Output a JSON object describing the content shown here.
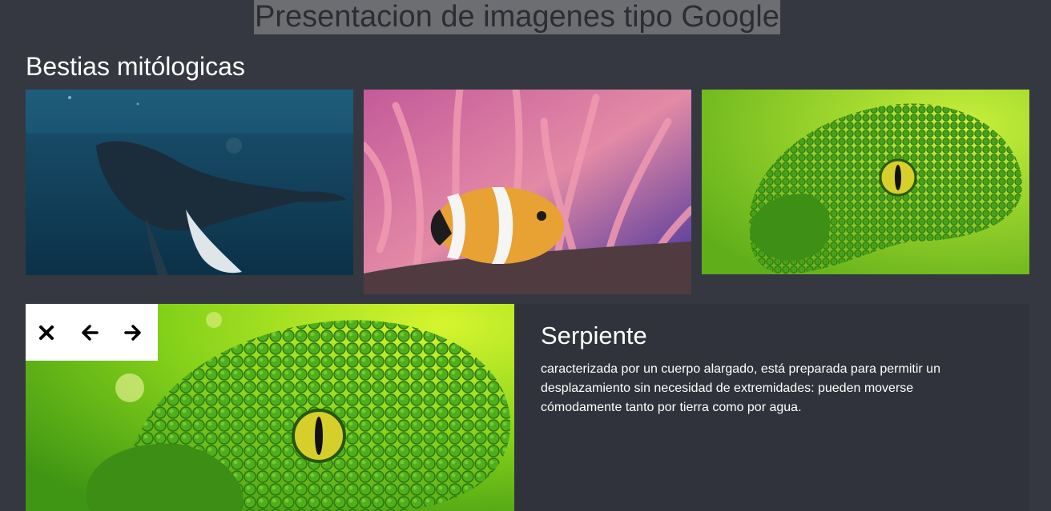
{
  "page": {
    "title": "Presentacion de imagenes tipo Google"
  },
  "gallery": {
    "heading": "Bestias mitólogicas",
    "thumbnails": [
      {
        "subject": "whale",
        "palette": [
          "#1a4a66",
          "#0e2e44"
        ]
      },
      {
        "subject": "clownfish",
        "palette": [
          "#e28aa8",
          "#2a2fa6"
        ]
      },
      {
        "subject": "snake",
        "palette": [
          "#8fd61a",
          "#2e7d12"
        ]
      }
    ]
  },
  "viewer": {
    "title": "Serpiente",
    "description": "caracterizada por un cuerpo alargado, está preparada para permitir un desplazamiento sin necesidad de extremidades: pueden moverse cómodamente tanto por tierra como por agua.",
    "controls": {
      "close": "close-icon",
      "previous": "arrow-left-icon",
      "next": "arrow-right-icon"
    }
  }
}
